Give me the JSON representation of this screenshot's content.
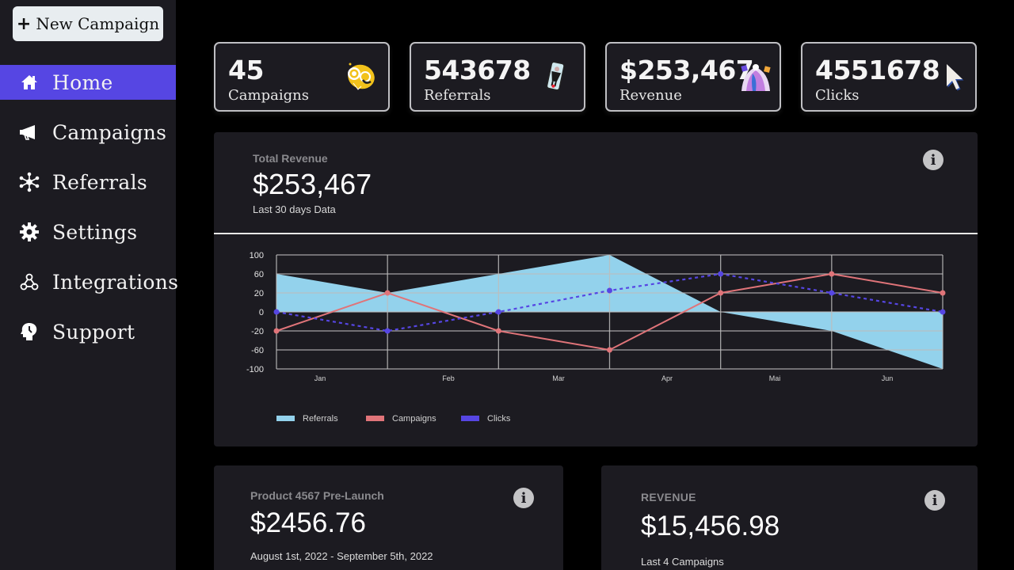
{
  "sidebar": {
    "new_campaign": {
      "icon": "plus-icon",
      "label": "New Campaign"
    },
    "items": [
      {
        "label": "Home",
        "icon": "home-icon",
        "active": true
      },
      {
        "label": "Campaigns",
        "icon": "megaphone-icon",
        "active": false
      },
      {
        "label": "Referrals",
        "icon": "network-icon",
        "active": false
      },
      {
        "label": "Settings",
        "icon": "gear-icon",
        "active": false
      },
      {
        "label": "Integrations",
        "icon": "webhook-icon",
        "active": false
      },
      {
        "label": "Support",
        "icon": "head-support-icon",
        "active": false
      }
    ],
    "accent": "#5646e3"
  },
  "stats": [
    {
      "value": "45",
      "label": "Campaigns",
      "illustration": "megaphone-illustration"
    },
    {
      "value": "543678",
      "label": "Referrals",
      "illustration": "phone-referral-illustration"
    },
    {
      "value": "$253,467",
      "label": "Revenue",
      "illustration": "shopping-illustration"
    },
    {
      "value": "4551678",
      "label": "Clicks",
      "illustration": "cursor-illustration"
    }
  ],
  "revenue_card": {
    "subtitle": "Total Revenue",
    "value": "$253,467",
    "note": "Last 30 days Data",
    "info_icon": "info-icon"
  },
  "chart_data": {
    "type": "line",
    "title": "",
    "xlabel": "",
    "ylabel": "",
    "categories": [
      "Jan",
      "Feb",
      "Mar",
      "Apr",
      "Mai",
      "Jun"
    ],
    "y_ticks": [
      100,
      60,
      20,
      0,
      -20,
      -60,
      -100
    ],
    "ylim": [
      -100,
      100
    ],
    "grid": true,
    "legend_position": "bottom-left",
    "point_count": 7,
    "series": [
      {
        "name": "Referrals",
        "kind": "area",
        "color": "#93d2ec",
        "values": [
          60,
          20,
          60,
          100,
          0,
          -20,
          -100
        ]
      },
      {
        "name": "Campaigns",
        "kind": "line",
        "color": "#e07479",
        "values": [
          -20,
          20,
          -20,
          -60,
          20,
          60,
          20
        ]
      },
      {
        "name": "Clicks",
        "kind": "dashed-line",
        "color": "#5646e3",
        "values": [
          0,
          -20,
          0,
          25,
          60,
          20,
          0
        ]
      }
    ]
  },
  "bottom_cards": [
    {
      "subtitle": "Product 4567 Pre-Launch",
      "value": "$2456.76",
      "note": "August 1st, 2022 - September 5th, 2022",
      "info_icon": "info-icon"
    },
    {
      "subtitle": "REVENUE",
      "value": "$15,456.98",
      "note": "Last 4 Campaigns",
      "info_icon": "info-icon"
    }
  ]
}
